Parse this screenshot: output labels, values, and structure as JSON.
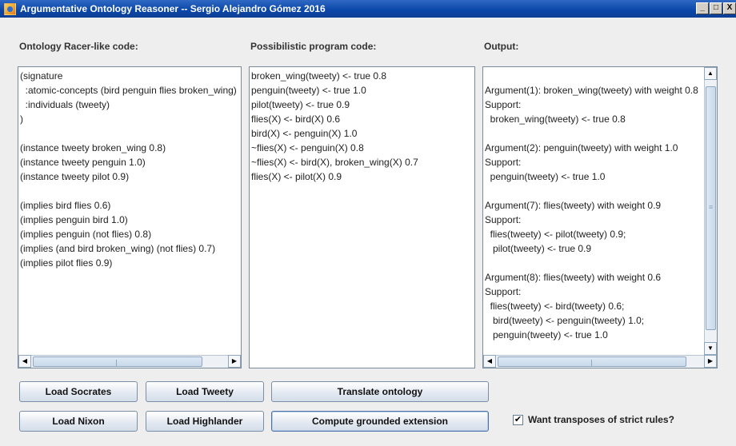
{
  "window": {
    "title": "Argumentative Ontology Reasoner -- Sergio Alejandro Gómez 2016",
    "controls": [
      "_",
      "□",
      "X"
    ]
  },
  "panels": {
    "ontology": {
      "label": "Ontology Racer-like code:",
      "text": "(signature\n  :atomic-concepts (bird penguin flies broken_wing)\n  :individuals (tweety)\n)\n\n(instance tweety broken_wing 0.8)\n(instance tweety penguin 1.0)\n(instance tweety pilot 0.9)\n\n(implies bird flies 0.6)\n(implies penguin bird 1.0)\n(implies penguin (not flies) 0.8)\n(implies (and bird broken_wing) (not flies) 0.7)\n(implies pilot flies 0.9)"
    },
    "program": {
      "label": "Possibilistic program code:",
      "text": "broken_wing(tweety) <- true 0.8\npenguin(tweety) <- true 1.0\npilot(tweety) <- true 0.9\nflies(X) <- bird(X) 0.6\nbird(X) <- penguin(X) 1.0\n~flies(X) <- penguin(X) 0.8\n~flies(X) <- bird(X), broken_wing(X) 0.7\nflies(X) <- pilot(X) 0.9"
    },
    "output": {
      "label": "Output:",
      "text": "\nArgument(1): broken_wing(tweety) with weight 0.8\nSupport:\n  broken_wing(tweety) <- true 0.8\n\nArgument(2): penguin(tweety) with weight 1.0\nSupport:\n  penguin(tweety) <- true 1.0\n\nArgument(7): flies(tweety) with weight 0.9\nSupport:\n  flies(tweety) <- pilot(tweety) 0.9;\n   pilot(tweety) <- true 0.9\n\nArgument(8): flies(tweety) with weight 0.6\nSupport:\n  flies(tweety) <- bird(tweety) 0.6;\n   bird(tweety) <- penguin(tweety) 1.0;\n   penguin(tweety) <- true 1.0"
    }
  },
  "buttons": {
    "load_socrates": "Load Socrates",
    "load_tweety": "Load Tweety",
    "translate": "Translate ontology",
    "load_nixon": "Load Nixon",
    "load_highlander": "Load Highlander",
    "compute": "Compute grounded extension"
  },
  "options": {
    "transposes_label": "Want transposes of strict rules?",
    "transposes_checked": "✔"
  },
  "icons": {
    "scroll_up": "▲",
    "scroll_down": "▼",
    "scroll_left": "◀",
    "scroll_right": "▶",
    "grip": "≡"
  },
  "colors": {
    "title_bar": "#0a46a8",
    "background": "#eeeeee"
  }
}
